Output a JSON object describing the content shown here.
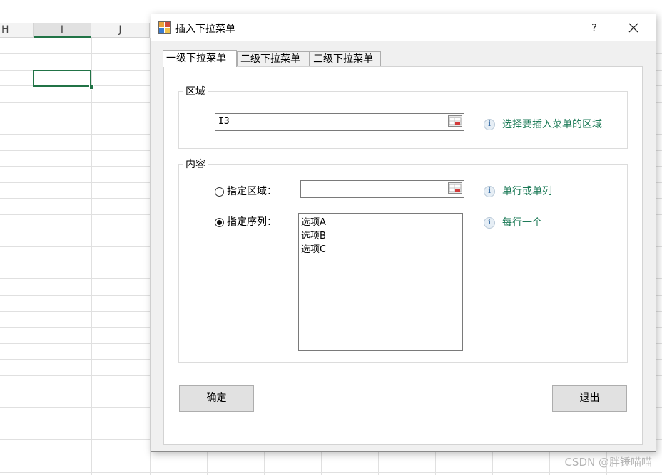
{
  "sheet": {
    "columns": [
      "H",
      "I",
      "J"
    ],
    "active_column": "I"
  },
  "dialog": {
    "title": "插入下拉菜单",
    "help_label": "?",
    "tabs": [
      {
        "label": "一级下拉菜单",
        "selected": true
      },
      {
        "label": "二级下拉菜单",
        "selected": false
      },
      {
        "label": "三级下拉菜单",
        "selected": false
      }
    ],
    "region_group": {
      "title": "区域",
      "value": "I3",
      "hint": "选择要插入菜单的区域"
    },
    "content_group": {
      "title": "内容",
      "option_range": {
        "label": "指定区域：",
        "checked": false,
        "value": "",
        "hint": "单行或单列"
      },
      "option_sequence": {
        "label": "指定序列：",
        "checked": true,
        "hint": "每行一个",
        "items": [
          "选项A",
          "选项B",
          "选项C"
        ]
      }
    },
    "buttons": {
      "ok": "确定",
      "exit": "退出"
    }
  },
  "watermark": "CSDN @胖锤喵喵",
  "colors": {
    "accent": "#217346",
    "hint_text": "#1e7b58"
  }
}
